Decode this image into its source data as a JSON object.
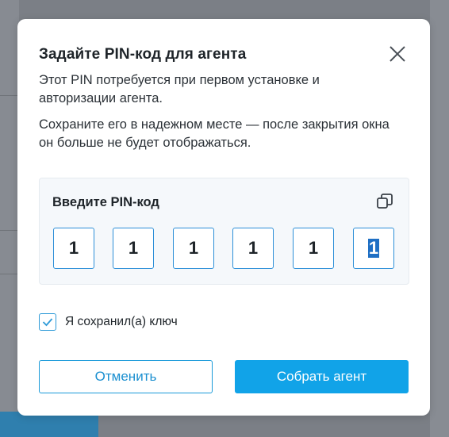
{
  "dialog": {
    "title": "Задайте PIN-код для агента",
    "paragraph1": "Этот PIN потребуется при первом установке и авторизации агента.",
    "paragraph2": "Сохраните его в надежном месте — после закрытия окна он больше не будет отображаться.",
    "pin_section": {
      "label": "Введите PIN-код",
      "digits": [
        "1",
        "1",
        "1",
        "1",
        "1",
        "1"
      ]
    },
    "checkbox": {
      "label": "Я сохранил(а) ключ",
      "checked": true
    },
    "buttons": {
      "cancel": "Отменить",
      "confirm": "Собрать агент"
    }
  },
  "colors": {
    "accent": "#11a3e8",
    "border_blue": "#2d8fd8",
    "overlay": "#7b7f86"
  }
}
